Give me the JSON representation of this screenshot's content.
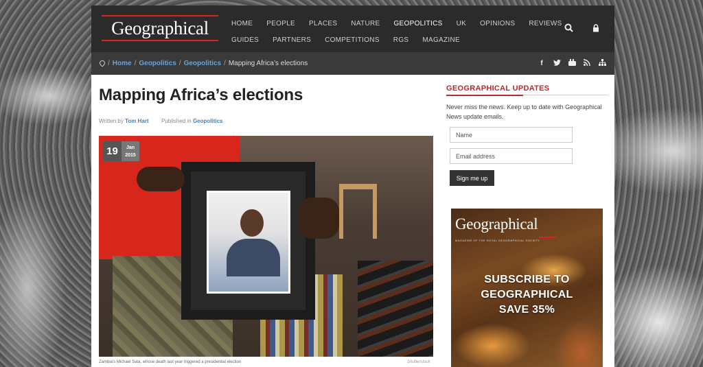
{
  "site": {
    "logo": "Geographical"
  },
  "nav": {
    "row1": [
      "HOME",
      "PEOPLE",
      "PLACES",
      "NATURE",
      "GEOPOLITICS",
      "UK",
      "OPINIONS",
      "REVIEWS"
    ],
    "row2": [
      "GUIDES",
      "PARTNERS",
      "COMPETITIONS",
      "RGS",
      "MAGAZINE"
    ],
    "active": "GEOPOLITICS"
  },
  "header_icons": [
    "search-icon",
    "lock-icon"
  ],
  "breadcrumb": {
    "items": [
      "Home",
      "Geopolitics",
      "Geopolitics"
    ],
    "current": "Mapping Africa’s elections",
    "separator": "/"
  },
  "social_icons": [
    "facebook-icon",
    "twitter-icon",
    "youtube-icon",
    "rss-icon",
    "sitemap-icon"
  ],
  "article": {
    "title": "Mapping Africa’s elections",
    "written_by_label": "Written by",
    "author": "Tom Hart",
    "published_label": "Published in",
    "category": "Geopolitics",
    "date": {
      "day": "19",
      "month": "Jan",
      "year": "2015"
    },
    "caption": "Zambia's Michael Sata, whose death last year triggered a presidential election",
    "credit": "Shutterstock"
  },
  "sidebar": {
    "heading": "GEOGRAPHICAL UPDATES",
    "text": "Never miss the news. Keep up to date with Geographical News update emails.",
    "name_placeholder": "Name",
    "email_placeholder": "Email address",
    "button": "Sign me up"
  },
  "ad": {
    "logo": "Geographical",
    "tagline": "MAGAZINE OF THE ROYAL GEOGRAPHICAL SOCIETY",
    "line1": "SUBSCRIBE TO",
    "line2": "GEOGRAPHICAL",
    "line3": "SAVE 35%"
  },
  "colors": {
    "brand_red": "#d8261f",
    "link_blue": "#4a7fb6",
    "header_bg": "#2b2b2b"
  }
}
